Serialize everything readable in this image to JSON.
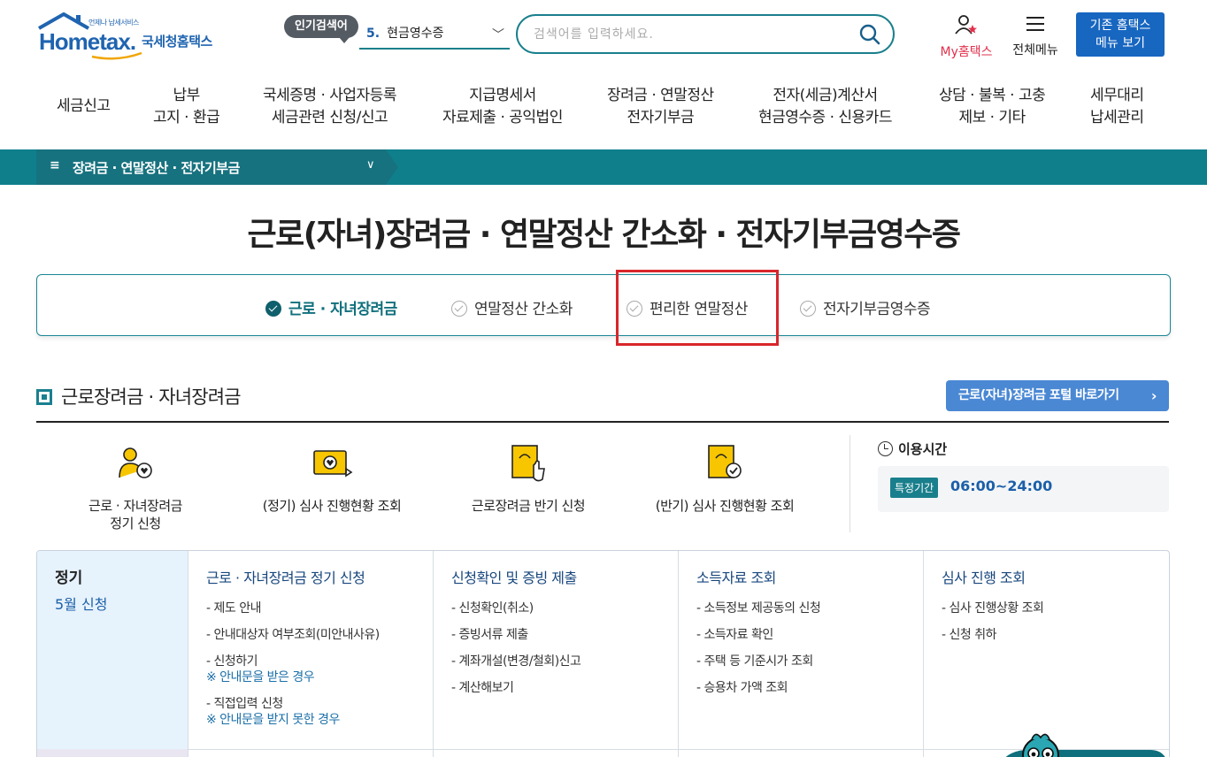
{
  "header": {
    "logo_tagline": "언제나 납세서비스",
    "logo_word": "Hometax.",
    "logo_kr": "국세청홈택스",
    "popular_label": "인기검색어",
    "popular_num": "5.",
    "popular_term": "현금영수증",
    "search_placeholder": "검색어를 입력하세요.",
    "my_label": "My홈택스",
    "allmenu_label": "전체메뉴",
    "old_btn_line1": "기존 홈택스",
    "old_btn_line2": "메뉴 보기"
  },
  "nav": [
    {
      "l1": "세금신고",
      "l2": ""
    },
    {
      "l1": "납부",
      "l2": "고지 · 환급"
    },
    {
      "l1": "국세증명 · 사업자등록",
      "l2": "세금관련 신청/신고"
    },
    {
      "l1": "지급명세서",
      "l2": "자료제출 · 공익법인"
    },
    {
      "l1": "장려금 · 연말정산",
      "l2": "전자기부금"
    },
    {
      "l1": "전자(세금)계산서",
      "l2": "현금영수증 · 신용카드"
    },
    {
      "l1": "상담 · 불복 · 고충",
      "l2": "제보 · 기타"
    },
    {
      "l1": "세무대리",
      "l2": "납세관리"
    }
  ],
  "breadcrumb": {
    "menu_glyph": "≡",
    "label": "장려금 · 연말정산 · 전자기부금"
  },
  "page_title": "근로(자녀)장려금 · 연말정산 간소화 · 전자기부금영수증",
  "tabs": [
    {
      "label": "근로 · 자녀장려금",
      "active": true
    },
    {
      "label": "연말정산 간소화",
      "active": false
    },
    {
      "label": "편리한 연말정산",
      "active": false
    },
    {
      "label": "전자기부금영수증",
      "active": false
    }
  ],
  "section": {
    "title": "근로장려금 · 자녀장려금",
    "portal_btn": "근로(자녀)장려금 포털 바로가기",
    "portal_arrow": "›"
  },
  "services": [
    {
      "line1": "근로 · 자녀장려금",
      "line2": "정기 신청",
      "icon": "person-heart-icon"
    },
    {
      "line1": "(정기) 심사 진행현황 조회",
      "line2": "",
      "icon": "monitor-heart-icon"
    },
    {
      "line1": "근로장려금 반기 신청",
      "line2": "",
      "icon": "document-hand-icon"
    },
    {
      "line1": "(반기) 심사 진행현황 조회",
      "line2": "",
      "icon": "document-check-icon"
    }
  ],
  "hours": {
    "title": "이용시간",
    "badge": "특정기간",
    "value": "06:00~24:00"
  },
  "grid": {
    "left_title": "정기",
    "left_sub": "5월 신청",
    "columns": [
      {
        "head": "근로 · 자녀장려금 정기 신청",
        "items": [
          {
            "text": "- 제도 안내"
          },
          {
            "text": "- 안내대상자 여부조회(미안내사유)"
          },
          {
            "text": "- 신청하기"
          },
          {
            "text": "※ 안내문을 받은 경우",
            "note": true
          },
          {
            "text": "- 직접입력 신청"
          },
          {
            "text": "※ 안내문을 받지 못한 경우",
            "note": true
          }
        ]
      },
      {
        "head": "신청확인 및 증빙 제출",
        "items": [
          {
            "text": "- 신청확인(취소)"
          },
          {
            "text": "- 증빙서류 제출"
          },
          {
            "text": "- 계좌개설(변경/철회)신고"
          },
          {
            "text": "- 계산해보기"
          }
        ]
      },
      {
        "head": "소득자료 조회",
        "items": [
          {
            "text": "- 소득정보 제공동의 신청"
          },
          {
            "text": "- 소득자료 확인"
          },
          {
            "text": "- 주택 등 기준시가 조회"
          },
          {
            "text": "- 승용차 가액 조회"
          }
        ]
      },
      {
        "head": "심사 진행 조회",
        "items": [
          {
            "text": "- 심사 진행상황 조회"
          },
          {
            "text": "- 신청 취하"
          }
        ]
      }
    ]
  },
  "colors": {
    "teal": "#0f7f8c",
    "blue": "#1766c0",
    "highlight": "#d7262b"
  }
}
